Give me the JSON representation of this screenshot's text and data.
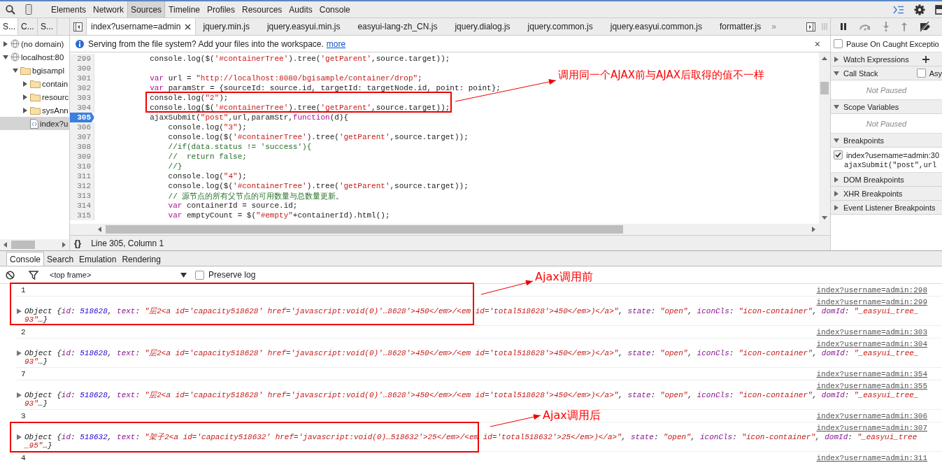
{
  "toolbar": {
    "panels": [
      {
        "label": "Elements",
        "selected": false
      },
      {
        "label": "Network",
        "selected": false
      },
      {
        "label": "Sources",
        "selected": true
      },
      {
        "label": "Timeline",
        "selected": false
      },
      {
        "label": "Profiles",
        "selected": false
      },
      {
        "label": "Resources",
        "selected": false
      },
      {
        "label": "Audits",
        "selected": false
      },
      {
        "label": "Console",
        "selected": false
      }
    ]
  },
  "navigator": {
    "tabs": [
      {
        "label": "S...",
        "selected": true
      },
      {
        "label": "C...",
        "selected": false
      },
      {
        "label": "S...",
        "selected": false
      }
    ],
    "tree": [
      {
        "label": "(no domain)",
        "kind": "domain",
        "expanded": false,
        "selected": false
      },
      {
        "label": "localhost:80",
        "kind": "domain",
        "expanded": true,
        "selected": false,
        "children": [
          {
            "label": "bgisampl",
            "kind": "folder",
            "expanded": true,
            "selected": false,
            "children": [
              {
                "label": "contain",
                "kind": "folder",
                "expanded": false,
                "selected": false
              },
              {
                "label": "resourc",
                "kind": "folder",
                "expanded": false,
                "selected": false
              },
              {
                "label": "sysAnn",
                "kind": "folder",
                "expanded": false,
                "selected": false
              },
              {
                "label": "index?u",
                "kind": "file",
                "selected": true
              }
            ]
          }
        ]
      }
    ]
  },
  "editor": {
    "tabs": [
      {
        "label": "index?username=admin",
        "selected": true,
        "closable": true
      },
      {
        "label": "jquery.min.js",
        "selected": false,
        "closable": false
      },
      {
        "label": "jquery.easyui.min.js",
        "selected": false,
        "closable": false
      },
      {
        "label": "easyui-lang-zh_CN.js",
        "selected": false,
        "closable": false
      },
      {
        "label": "jquery.dialog.js",
        "selected": false,
        "closable": false
      },
      {
        "label": "jquery.common.js",
        "selected": false,
        "closable": false
      },
      {
        "label": "jquery.easyui.common.js",
        "selected": false,
        "closable": false
      },
      {
        "label": "formatter.js",
        "selected": false,
        "closable": false
      }
    ],
    "more_tabs": "»",
    "infobar": {
      "message": "Serving from the file system? Add your files into the workspace.",
      "link": "more",
      "close": "×"
    },
    "lines": [
      {
        "number": "299",
        "breakpoint": false,
        "tokens": [
          {
            "kind": "plain",
            "text": "            console.log($("
          },
          {
            "kind": "string",
            "text": "'#containerTree'"
          },
          {
            "kind": "plain",
            "text": ").tree("
          },
          {
            "kind": "string",
            "text": "'getParent'"
          },
          {
            "kind": "plain",
            "text": ",source.target));"
          }
        ]
      },
      {
        "number": "300",
        "breakpoint": false
      },
      {
        "number": "301",
        "breakpoint": false,
        "tokens": [
          {
            "kind": "keyword",
            "text": "            var"
          },
          {
            "kind": "plain",
            "text": " url = "
          },
          {
            "kind": "string",
            "text": "\"http://localhost:8080/bgisample/container/drop\""
          },
          {
            "kind": "plain",
            "text": ";"
          }
        ]
      },
      {
        "number": "302",
        "breakpoint": false,
        "tokens": [
          {
            "kind": "keyword",
            "text": "            var"
          },
          {
            "kind": "plain",
            "text": " paramStr = {sourceId: source.id, targetId: targetNode.id, point: point};"
          }
        ]
      },
      {
        "number": "303",
        "breakpoint": false,
        "tokens": [
          {
            "kind": "plain",
            "text": "            console.log("
          },
          {
            "kind": "string",
            "text": "\"2\""
          },
          {
            "kind": "plain",
            "text": ");"
          }
        ]
      },
      {
        "number": "304",
        "breakpoint": false,
        "tokens": [
          {
            "kind": "plain",
            "text": "            console.log($("
          },
          {
            "kind": "string",
            "text": "'#containerTree'"
          },
          {
            "kind": "plain",
            "text": ").tree("
          },
          {
            "kind": "string",
            "text": "'getParent'"
          },
          {
            "kind": "plain",
            "text": ",source.target));"
          }
        ]
      },
      {
        "number": "305",
        "breakpoint": true,
        "tokens": [
          {
            "kind": "plain",
            "text": "            ajaxSubmit("
          },
          {
            "kind": "string",
            "text": "\"post\""
          },
          {
            "kind": "plain",
            "text": ",url,paramStr,"
          },
          {
            "kind": "keyword",
            "text": "function"
          },
          {
            "kind": "plain",
            "text": "(d){"
          }
        ]
      },
      {
        "number": "306",
        "breakpoint": false,
        "tokens": [
          {
            "kind": "plain",
            "text": "                console.log("
          },
          {
            "kind": "string",
            "text": "\"3\""
          },
          {
            "kind": "plain",
            "text": ");"
          }
        ]
      },
      {
        "number": "307",
        "breakpoint": false,
        "tokens": [
          {
            "kind": "plain",
            "text": "                console.log($("
          },
          {
            "kind": "string",
            "text": "'#containerTree'"
          },
          {
            "kind": "plain",
            "text": ").tree("
          },
          {
            "kind": "string",
            "text": "'getParent'"
          },
          {
            "kind": "plain",
            "text": ",source.target));"
          }
        ]
      },
      {
        "number": "308",
        "breakpoint": false,
        "tokens": [
          {
            "kind": "comment",
            "text": "                //if(data.status != 'success'){"
          }
        ]
      },
      {
        "number": "309",
        "breakpoint": false,
        "tokens": [
          {
            "kind": "comment",
            "text": "                //  return false;"
          }
        ]
      },
      {
        "number": "310",
        "breakpoint": false,
        "tokens": [
          {
            "kind": "comment",
            "text": "                //}"
          }
        ]
      },
      {
        "number": "311",
        "breakpoint": false,
        "tokens": [
          {
            "kind": "plain",
            "text": "                console.log("
          },
          {
            "kind": "string",
            "text": "\"4\""
          },
          {
            "kind": "plain",
            "text": ");"
          }
        ]
      },
      {
        "number": "312",
        "breakpoint": false,
        "tokens": [
          {
            "kind": "plain",
            "text": "                console.log($("
          },
          {
            "kind": "string",
            "text": "'#containerTree'"
          },
          {
            "kind": "plain",
            "text": ").tree("
          },
          {
            "kind": "string",
            "text": "'getParent'"
          },
          {
            "kind": "plain",
            "text": ",source.target));"
          }
        ]
      },
      {
        "number": "313",
        "breakpoint": false,
        "tokens": [
          {
            "kind": "comment",
            "text": "                // 源节点的所有父节点的可用数量与总数量更新。"
          }
        ]
      },
      {
        "number": "314",
        "breakpoint": false,
        "tokens": [
          {
            "kind": "keyword",
            "text": "                var"
          },
          {
            "kind": "plain",
            "text": " containerId = source.id;"
          }
        ]
      },
      {
        "number": "315",
        "breakpoint": false,
        "tokens": [
          {
            "kind": "keyword",
            "text": "                var"
          },
          {
            "kind": "plain",
            "text": " emptyCount = $("
          },
          {
            "kind": "string",
            "text": "\"#empty\""
          },
          {
            "kind": "plain",
            "text": "+containerId).html();"
          }
        ]
      }
    ],
    "status": "Line 305, Column 1",
    "pretty_print": "{}"
  },
  "debugger": {
    "pause_on_caught": {
      "label": "Pause On Caught Exceptio",
      "checked": false
    },
    "sections": [
      {
        "title": "Watch Expressions",
        "expanded": false,
        "kind": "watch"
      },
      {
        "title": "Call Stack",
        "expanded": true,
        "kind": "callstack",
        "option": {
          "label": "Asy",
          "checked": false
        },
        "empty_text": "Not Paused"
      },
      {
        "title": "Scope Variables",
        "expanded": true,
        "kind": "plain",
        "empty_text": "Not Paused"
      },
      {
        "title": "Breakpoints",
        "expanded": true,
        "kind": "breakpoints",
        "items": [
          {
            "location": "index?username=admin:30",
            "code": "ajaxSubmit(\"post\",url",
            "checked": true
          }
        ]
      },
      {
        "title": "DOM Breakpoints",
        "expanded": false,
        "kind": "plain"
      },
      {
        "title": "XHR Breakpoints",
        "expanded": false,
        "kind": "plain"
      },
      {
        "title": "Event Listener Breakpoints",
        "expanded": false,
        "kind": "plain"
      }
    ]
  },
  "drawer": {
    "tabs": [
      {
        "label": "Console",
        "selected": true
      },
      {
        "label": "Search",
        "selected": false
      },
      {
        "label": "Emulation",
        "selected": false
      },
      {
        "label": "Rendering",
        "selected": false
      }
    ],
    "frame_select": "<top frame>",
    "preserve_log": {
      "label": "Preserve log",
      "checked": false
    },
    "entries": [
      {
        "kind": "log",
        "text": "1",
        "source": "index?username=admin:298"
      },
      {
        "kind": "object",
        "source": "index?username=admin:299",
        "line_1": [
          {
            "kind": "plain",
            "text": "Object {"
          },
          {
            "kind": "key",
            "text": "id"
          },
          {
            "kind": "plain",
            "text": ": "
          },
          {
            "kind": "number",
            "text": "518628"
          },
          {
            "kind": "plain",
            "text": ", "
          },
          {
            "kind": "key",
            "text": "text"
          },
          {
            "kind": "plain",
            "text": ": "
          },
          {
            "kind": "string",
            "text": "\"层2<a id='capacity518628' href='javascript:void(0)'…8628'>450</em>/<em id='total518628'>450</em>)</a>\""
          },
          {
            "kind": "plain",
            "text": ", "
          },
          {
            "kind": "key",
            "text": "state"
          },
          {
            "kind": "plain",
            "text": ": "
          },
          {
            "kind": "string",
            "text": "\"open\""
          },
          {
            "kind": "plain",
            "text": ", "
          },
          {
            "kind": "key",
            "text": "iconCls"
          },
          {
            "kind": "plain",
            "text": ": "
          },
          {
            "kind": "string",
            "text": "\"icon-container\""
          },
          {
            "kind": "plain",
            "text": ", "
          },
          {
            "kind": "key",
            "text": "domId"
          },
          {
            "kind": "plain",
            "text": ": "
          },
          {
            "kind": "string",
            "text": "\"_easyui_tree_"
          }
        ],
        "line_2": [
          {
            "kind": "string",
            "text": "93\""
          },
          {
            "kind": "plain",
            "text": "…}"
          }
        ]
      },
      {
        "kind": "log",
        "text": "2",
        "source": "index?username=admin:303"
      },
      {
        "kind": "object",
        "source": "index?username=admin:304",
        "line_1": [
          {
            "kind": "plain",
            "text": "Object {"
          },
          {
            "kind": "key",
            "text": "id"
          },
          {
            "kind": "plain",
            "text": ": "
          },
          {
            "kind": "number",
            "text": "518628"
          },
          {
            "kind": "plain",
            "text": ", "
          },
          {
            "kind": "key",
            "text": "text"
          },
          {
            "kind": "plain",
            "text": ": "
          },
          {
            "kind": "string",
            "text": "\"层2<a id='capacity518628' href='javascript:void(0)'…8628'>450</em>/<em id='total518628'>450</em>)</a>\""
          },
          {
            "kind": "plain",
            "text": ", "
          },
          {
            "kind": "key",
            "text": "state"
          },
          {
            "kind": "plain",
            "text": ": "
          },
          {
            "kind": "string",
            "text": "\"open\""
          },
          {
            "kind": "plain",
            "text": ", "
          },
          {
            "kind": "key",
            "text": "iconCls"
          },
          {
            "kind": "plain",
            "text": ": "
          },
          {
            "kind": "string",
            "text": "\"icon-container\""
          },
          {
            "kind": "plain",
            "text": ", "
          },
          {
            "kind": "key",
            "text": "domId"
          },
          {
            "kind": "plain",
            "text": ": "
          },
          {
            "kind": "string",
            "text": "\"_easyui_tree_"
          }
        ],
        "line_2": [
          {
            "kind": "string",
            "text": "93\""
          },
          {
            "kind": "plain",
            "text": "…}"
          }
        ]
      },
      {
        "kind": "log",
        "text": "7",
        "source": "index?username=admin:354"
      },
      {
        "kind": "object",
        "source": "index?username=admin:355",
        "line_1": [
          {
            "kind": "plain",
            "text": "Object {"
          },
          {
            "kind": "key",
            "text": "id"
          },
          {
            "kind": "plain",
            "text": ": "
          },
          {
            "kind": "number",
            "text": "518628"
          },
          {
            "kind": "plain",
            "text": ", "
          },
          {
            "kind": "key",
            "text": "text"
          },
          {
            "kind": "plain",
            "text": ": "
          },
          {
            "kind": "string",
            "text": "\"层2<a id='capacity518628' href='javascript:void(0)'…8628'>450</em>/<em id='total518628'>450</em>)</a>\""
          },
          {
            "kind": "plain",
            "text": ", "
          },
          {
            "kind": "key",
            "text": "state"
          },
          {
            "kind": "plain",
            "text": ": "
          },
          {
            "kind": "string",
            "text": "\"open\""
          },
          {
            "kind": "plain",
            "text": ", "
          },
          {
            "kind": "key",
            "text": "iconCls"
          },
          {
            "kind": "plain",
            "text": ": "
          },
          {
            "kind": "string",
            "text": "\"icon-container\""
          },
          {
            "kind": "plain",
            "text": ", "
          },
          {
            "kind": "key",
            "text": "domId"
          },
          {
            "kind": "plain",
            "text": ": "
          },
          {
            "kind": "string",
            "text": "\"_easyui_tree_"
          }
        ],
        "line_2": [
          {
            "kind": "string",
            "text": "93\""
          },
          {
            "kind": "plain",
            "text": "…}"
          }
        ]
      },
      {
        "kind": "log",
        "text": "3",
        "source": "index?username=admin:306"
      },
      {
        "kind": "object",
        "source": "index?username=admin:307",
        "line_1": [
          {
            "kind": "plain",
            "text": "Object {"
          },
          {
            "kind": "key",
            "text": "id"
          },
          {
            "kind": "plain",
            "text": ": "
          },
          {
            "kind": "number",
            "text": "518632"
          },
          {
            "kind": "plain",
            "text": ", "
          },
          {
            "kind": "key",
            "text": "text"
          },
          {
            "kind": "plain",
            "text": ": "
          },
          {
            "kind": "string",
            "text": "\"架子2<a id='capacity518632' href='javascript:void(0)…518632'>25</em>/<em id='total518632'>25</em>)</a>\""
          },
          {
            "kind": "plain",
            "text": ", "
          },
          {
            "kind": "key",
            "text": "state"
          },
          {
            "kind": "plain",
            "text": ": "
          },
          {
            "kind": "string",
            "text": "\"open\""
          },
          {
            "kind": "plain",
            "text": ", "
          },
          {
            "kind": "key",
            "text": "iconCls"
          },
          {
            "kind": "plain",
            "text": ": "
          },
          {
            "kind": "string",
            "text": "\"icon-container\""
          },
          {
            "kind": "plain",
            "text": ", "
          },
          {
            "kind": "key",
            "text": "domId"
          },
          {
            "kind": "plain",
            "text": ": "
          },
          {
            "kind": "string",
            "text": "\"_easyui_tree"
          }
        ],
        "line_2": [
          {
            "kind": "string",
            "text": "_95\""
          },
          {
            "kind": "plain",
            "text": "…}"
          }
        ]
      },
      {
        "kind": "log",
        "text": "4",
        "source": "index?username=admin:311"
      }
    ]
  },
  "annotations": [
    {
      "kind": "code",
      "text": "调用同一个AJAX前与AJAX后取得的值不一样"
    },
    {
      "kind": "before",
      "text": "Ajax调用前"
    },
    {
      "kind": "after",
      "text": "Ajax调用后"
    }
  ]
}
